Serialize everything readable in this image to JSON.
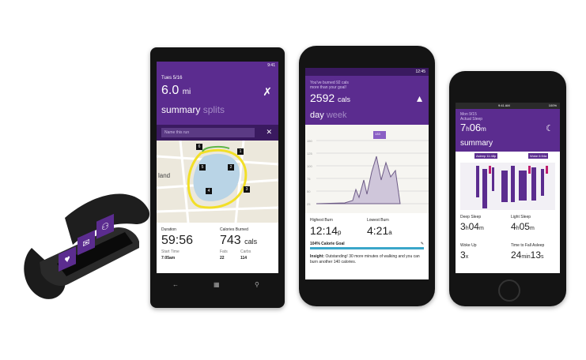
{
  "colors": {
    "accent": "#5b2c8f",
    "accent_light": "#9a74c8",
    "line": "#3aa6c9",
    "dark": "#141414"
  },
  "band": {
    "buttons": [
      "heart-icon",
      "mail-icon",
      "run-icon"
    ]
  },
  "wp": {
    "status_time": "9:41",
    "date": "Tues 5/16",
    "distance_value": "6.0",
    "distance_unit": "mi",
    "tab_active": "summary",
    "tab_inactive": "splits",
    "run_name_placeholder": "Name this run",
    "duration_label": "Duration",
    "duration_value": "59:56",
    "calories_label": "Calories Burned",
    "calories_value": "743",
    "calories_unit": "cals",
    "start_time_label": "Start Time",
    "start_time_value": "7:05am",
    "fats_label": "Fats",
    "fats_value": "22",
    "carbs_label": "Carbs",
    "carbs_value": "114",
    "map_label": "land",
    "map_marker_labels": [
      "6",
      "5",
      "4",
      "3",
      "2",
      "1"
    ]
  },
  "android": {
    "status_time": "12:45",
    "message_line1": "You've burned 92 cals",
    "message_line2": "more than your goal!",
    "calories_value": "2592",
    "calories_unit": "cals",
    "tab_active": "day",
    "tab_inactive": "week",
    "highest_label": "Highest Burn",
    "highest_value": "12:14",
    "highest_suffix": "p",
    "lowest_label": "Lowest Burn",
    "lowest_value": "4:21",
    "lowest_suffix": "a",
    "goal_label": "104% Calorie Goal",
    "insight_prefix": "Insight:",
    "insight_text": "Outstanding! 30 more minutes of walking and you can burn another 140 calories.",
    "heart_callout": "133",
    "y_ticks": [
      "150",
      "125",
      "100",
      "75",
      "50",
      "25"
    ],
    "x_ticks": [
      "12a",
      "12p",
      "12a"
    ]
  },
  "iphone": {
    "status_time": "9:41 AM",
    "status_battery": "100%",
    "date": "Mon 9/15",
    "section_label": "Actual Sleep",
    "sleep_hours": "7",
    "sleep_h_unit": "h",
    "sleep_minutes": "06",
    "sleep_m_unit": "m",
    "tab_label": "summary",
    "chart_top_labels": [
      "Asleep 11:48p",
      "Woke 6:54a"
    ],
    "deep_label": "Deep Sleep",
    "deep_h": "3",
    "deep_h_unit": "h",
    "deep_m": "04",
    "deep_m_unit": "m",
    "light_label": "Light Sleep",
    "light_h": "4",
    "light_h_unit": "h",
    "light_m": "05",
    "light_m_unit": "m",
    "woke_label": "Woke Up",
    "woke_value": "3",
    "woke_unit": "x",
    "fall_label": "Time to Fall Asleep",
    "fall_min": "24",
    "fall_min_unit": "min",
    "fall_sec": "13",
    "fall_sec_unit": "s"
  }
}
